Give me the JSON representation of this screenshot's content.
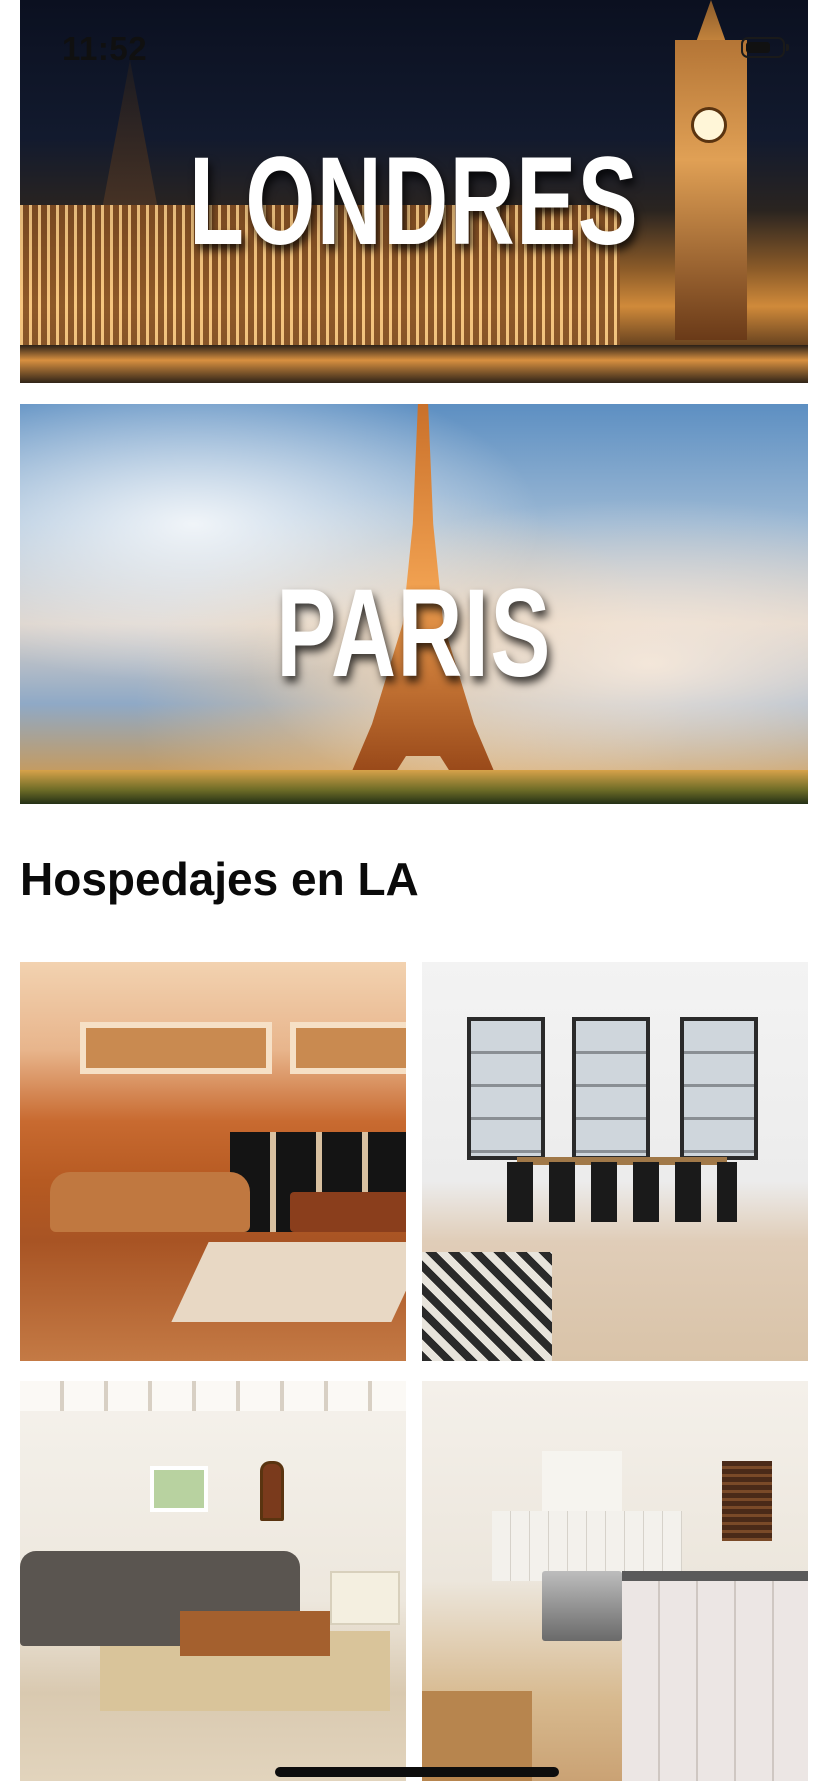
{
  "status_bar": {
    "time": "11:52"
  },
  "cities": [
    {
      "title": "LONDRES"
    },
    {
      "title": "PARIS"
    }
  ],
  "section": {
    "title": "Hospedajes en LA"
  },
  "listings": [
    {
      "description": "living room with billiard table"
    },
    {
      "description": "dining room with black chairs"
    },
    {
      "description": "living room with grey sofa"
    },
    {
      "description": "white kitchen"
    }
  ]
}
